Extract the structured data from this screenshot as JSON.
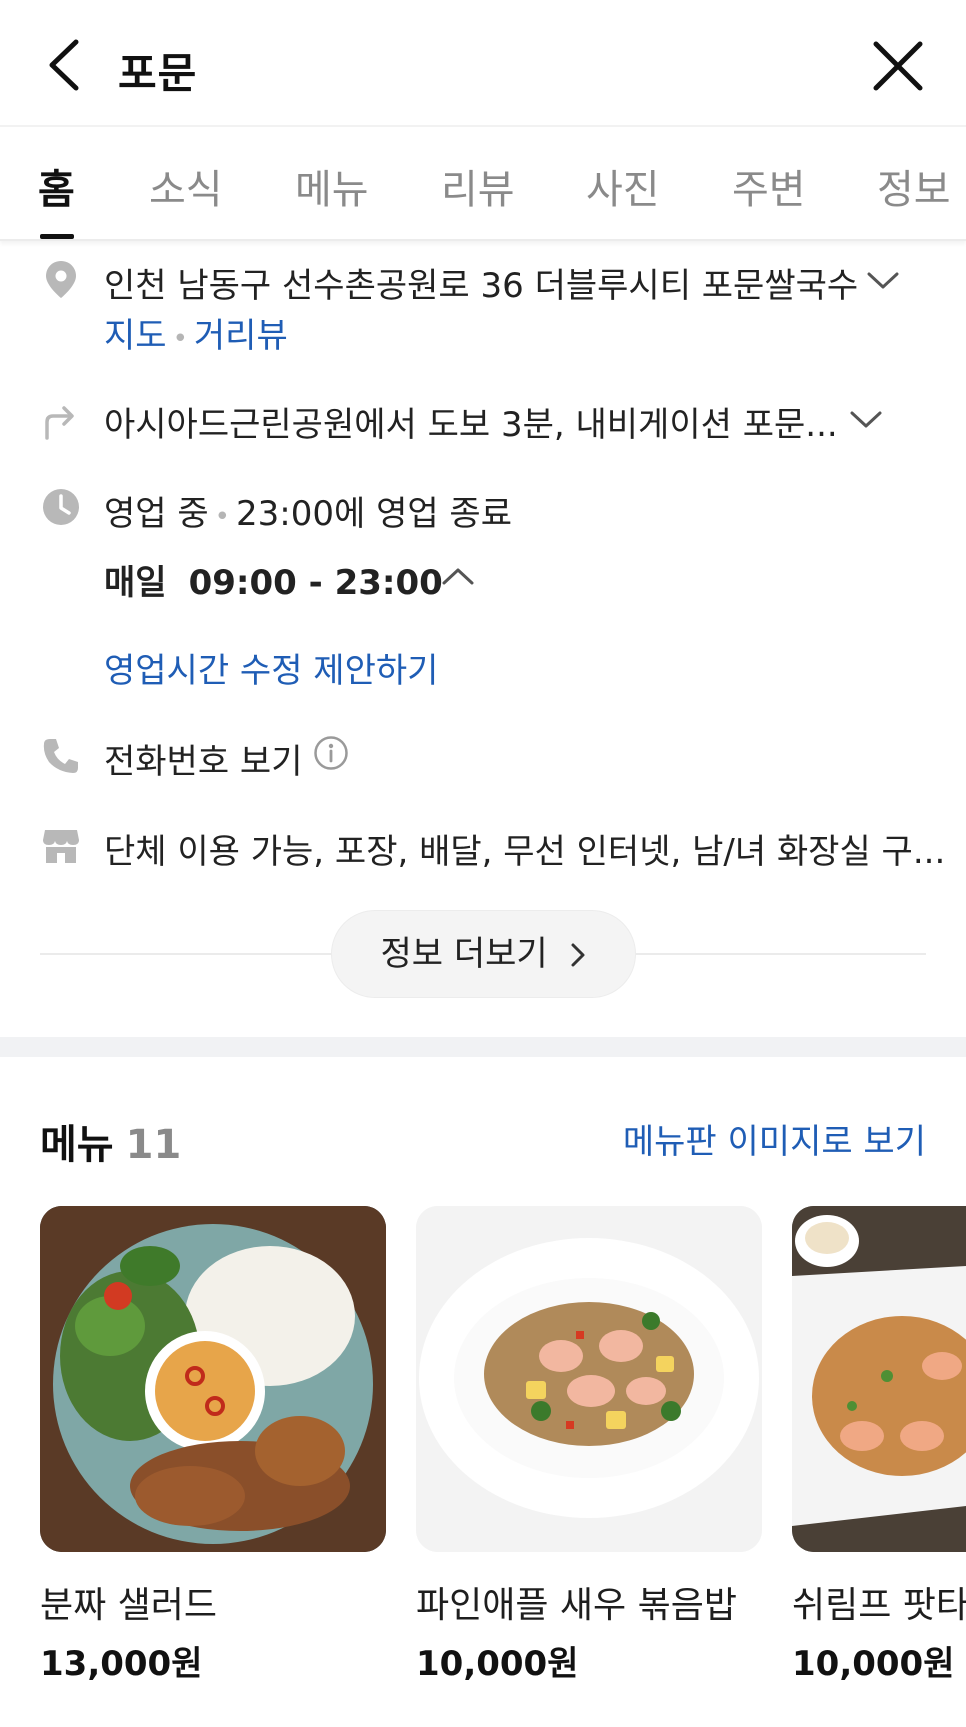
{
  "header": {
    "title": "포문"
  },
  "tabs": [
    "홈",
    "소식",
    "메뉴",
    "리뷰",
    "사진",
    "주변",
    "정보"
  ],
  "info": {
    "address": "인천 남동구 선수촌공원로 36 더블루시티 포문쌀국수",
    "map_link": "지도",
    "street_view_link": "거리뷰",
    "directions": "아시아드근린공원에서 도보 3분, 내비게이션 포문...",
    "status": "영업 중",
    "closing": "23:00에 영업 종료",
    "hours_day": "매일",
    "hours_time": "09:00 - 23:00",
    "suggest_hours_link": "영업시간 수정 제안하기",
    "phone_label": "전화번호 보기",
    "facilities": "단체 이용 가능, 포장, 배달, 무선 인터넷, 남/녀 화장실 구...",
    "more_button": "정보 더보기"
  },
  "menu": {
    "title": "메뉴",
    "count": "11",
    "board_link": "메뉴판 이미지로 보기",
    "items": [
      {
        "name": "분짜 샐러드",
        "price": "13,000원"
      },
      {
        "name": "파인애플 새우 볶음밥",
        "price": "10,000원"
      },
      {
        "name": "쉬림프 팟타",
        "price": "10,000원"
      }
    ]
  },
  "colors": {
    "link": "#1f5db5",
    "icon_gray": "#b8b8b8",
    "text": "#1e1e1e"
  }
}
